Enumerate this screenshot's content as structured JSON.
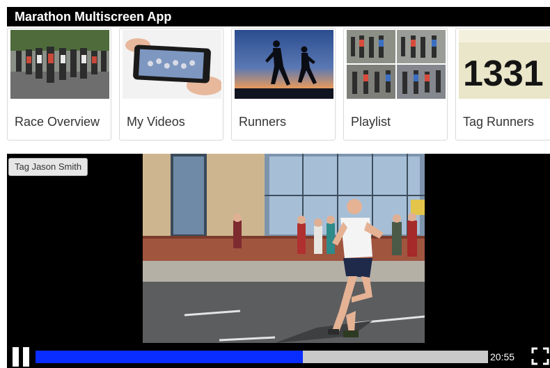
{
  "app": {
    "title": "Marathon Multiscreen App"
  },
  "tiles": [
    {
      "label": "Race Overview",
      "thumb": "crowd-of-runners-photo"
    },
    {
      "label": "My Videos",
      "thumb": "phone-recording-photo"
    },
    {
      "label": "Runners",
      "thumb": "runner-silhouettes-sunset-photo"
    },
    {
      "label": "Playlist",
      "thumb": "runner-photo-grid"
    },
    {
      "label": "Tag Runners",
      "thumb": "race-bib-number-photo",
      "bib_number": "1331"
    }
  ],
  "player": {
    "tag_button_label": "Tag Jason Smith",
    "time": "20:55",
    "progress_fraction": 0.59,
    "colors": {
      "progress_fill": "#0a2dff",
      "progress_track": "#c9c9c9"
    },
    "icons": {
      "play_state": "pause-icon",
      "fullscreen": "fullscreen-icon"
    }
  }
}
